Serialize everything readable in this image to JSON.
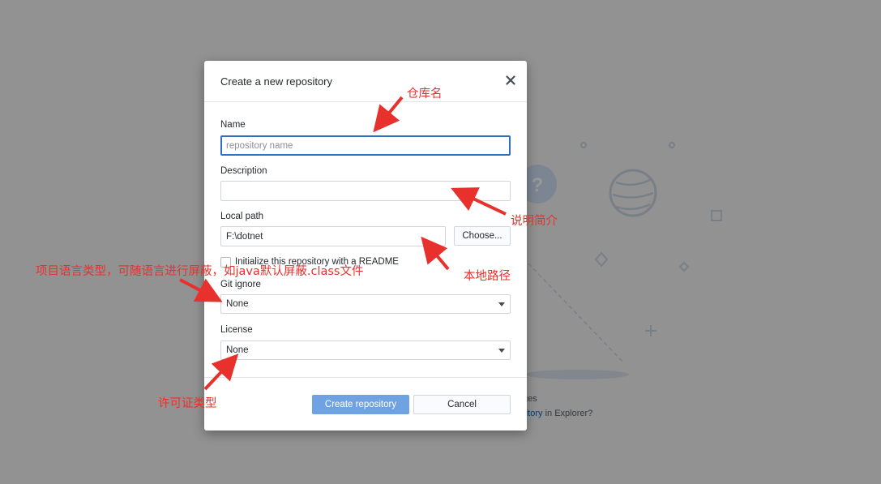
{
  "background": {
    "text_changes": "ges",
    "text_link": "pository",
    "text_after_link": " in Explorer?"
  },
  "dialog": {
    "title": "Create a new repository",
    "close_icon": "close-icon",
    "name": {
      "label": "Name",
      "placeholder": "repository name",
      "value": ""
    },
    "description": {
      "label": "Description",
      "value": ""
    },
    "local_path": {
      "label": "Local path",
      "value": "F:\\dotnet",
      "choose_label": "Choose..."
    },
    "readme": {
      "label": "Initialize this repository with a README",
      "checked": false
    },
    "git_ignore": {
      "label": "Git ignore",
      "selected": "None"
    },
    "license": {
      "label": "License",
      "selected": "None"
    },
    "create_label": "Create repository",
    "cancel_label": "Cancel"
  },
  "annotations": {
    "repo_name": "仓库名",
    "description": "说明简介",
    "local_path": "本地路径",
    "git_ignore": "项目语言类型，可随语言进行屏蔽，如java默认屏蔽.class文件",
    "license": "许可证类型"
  },
  "colors": {
    "accent": "#6ea2e3",
    "focus_border": "#2f6fbf",
    "annotation": "#e8302c",
    "overlay": "rgba(0,0,0,0.40)"
  }
}
